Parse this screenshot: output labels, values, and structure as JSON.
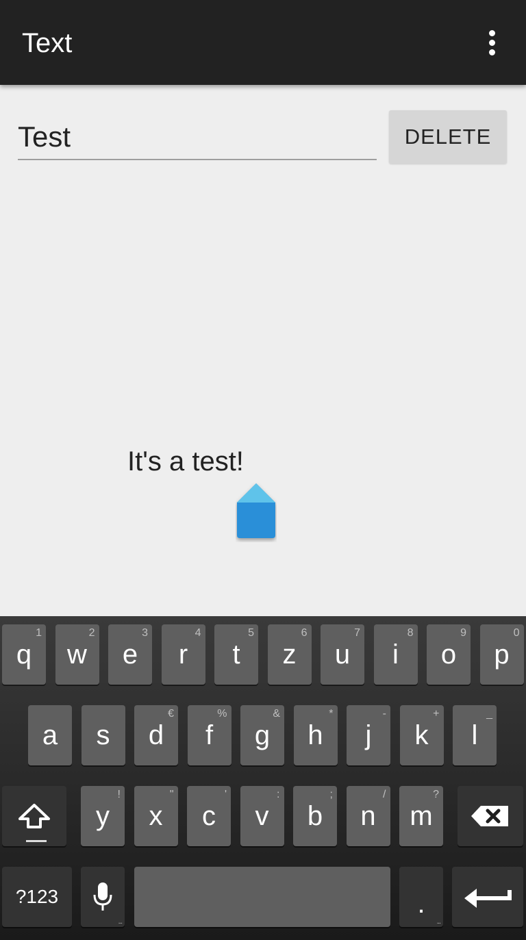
{
  "action_bar": {
    "title": "Text",
    "overflow_icon": "more-vert-icon"
  },
  "edit_text": {
    "value": "Test"
  },
  "delete_button": {
    "label": "DELETE"
  },
  "output_text": "It's a test!",
  "colors": {
    "action_bar": "#222222",
    "background": "#eeeeee",
    "cursor_handle": "#2a8fd8"
  },
  "keyboard": {
    "row1": [
      {
        "label": "q",
        "hint": "1"
      },
      {
        "label": "w",
        "hint": "2"
      },
      {
        "label": "e",
        "hint": "3"
      },
      {
        "label": "r",
        "hint": "4"
      },
      {
        "label": "t",
        "hint": "5"
      },
      {
        "label": "z",
        "hint": "6"
      },
      {
        "label": "u",
        "hint": "7"
      },
      {
        "label": "i",
        "hint": "8"
      },
      {
        "label": "o",
        "hint": "9"
      },
      {
        "label": "p",
        "hint": "0"
      }
    ],
    "row2": [
      {
        "label": "a",
        "hint": ""
      },
      {
        "label": "s",
        "hint": ""
      },
      {
        "label": "d",
        "hint": "€"
      },
      {
        "label": "f",
        "hint": "%"
      },
      {
        "label": "g",
        "hint": "&"
      },
      {
        "label": "h",
        "hint": "*"
      },
      {
        "label": "j",
        "hint": "-"
      },
      {
        "label": "k",
        "hint": "+"
      },
      {
        "label": "l",
        "hint": "_"
      }
    ],
    "row3": [
      {
        "label": "y",
        "hint": "!"
      },
      {
        "label": "x",
        "hint": "\""
      },
      {
        "label": "c",
        "hint": "'"
      },
      {
        "label": "v",
        "hint": ":"
      },
      {
        "label": "b",
        "hint": ";"
      },
      {
        "label": "n",
        "hint": "/"
      },
      {
        "label": "m",
        "hint": "?"
      }
    ],
    "symbols_label": "?123",
    "period_label": ".",
    "shift_icon": "shift-icon",
    "backspace_icon": "backspace-icon",
    "mic_icon": "mic-icon",
    "enter_icon": "enter-icon"
  }
}
